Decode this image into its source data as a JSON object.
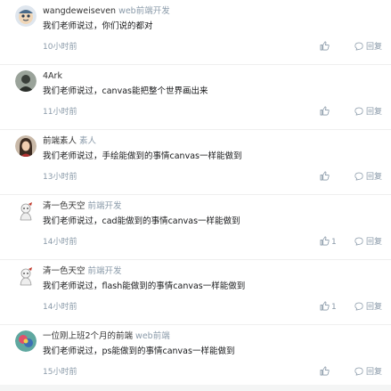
{
  "colors": {
    "text": "#17181a",
    "meta": "#8a9aa9",
    "divider": "#efefef"
  },
  "comments": [
    {
      "username": "wangdeweiseven",
      "title": "web前端开发",
      "content": "我们老师说过，你们说的都对",
      "time": "10小时前",
      "likes": "",
      "reply_label": "回复",
      "avatar": "avatar-cartoon-face"
    },
    {
      "username": "4Ark",
      "title": "",
      "content": "我们老师说过，canvas能把整个世界画出来",
      "time": "11小时前",
      "likes": "",
      "reply_label": "回复",
      "avatar": "avatar-dark-photo"
    },
    {
      "username": "前端素人",
      "title": "素人",
      "content": "我们老师说过，手绘能做到的事情canvas一样能做到",
      "time": "13小时前",
      "likes": "",
      "reply_label": "回复",
      "avatar": "avatar-woman-photo"
    },
    {
      "username": "清一色天空",
      "title": "前端开发",
      "content": "我们老师说过，cad能做到的事情canvas一样能做到",
      "time": "14小时前",
      "likes": "1",
      "reply_label": "回复",
      "avatar": "avatar-white-character"
    },
    {
      "username": "清一色天空",
      "title": "前端开发",
      "content": "我们老师说过，flash能做到的事情canvas一样能做到",
      "time": "14小时前",
      "likes": "1",
      "reply_label": "回复",
      "avatar": "avatar-white-character"
    },
    {
      "username": "一位刚上班2个月的前端",
      "title": "web前端",
      "content": "我们老师说过，ps能做到的事情canvas一样能做到",
      "time": "15小时前",
      "likes": "",
      "reply_label": "回复",
      "avatar": "avatar-colorful-circle"
    }
  ]
}
